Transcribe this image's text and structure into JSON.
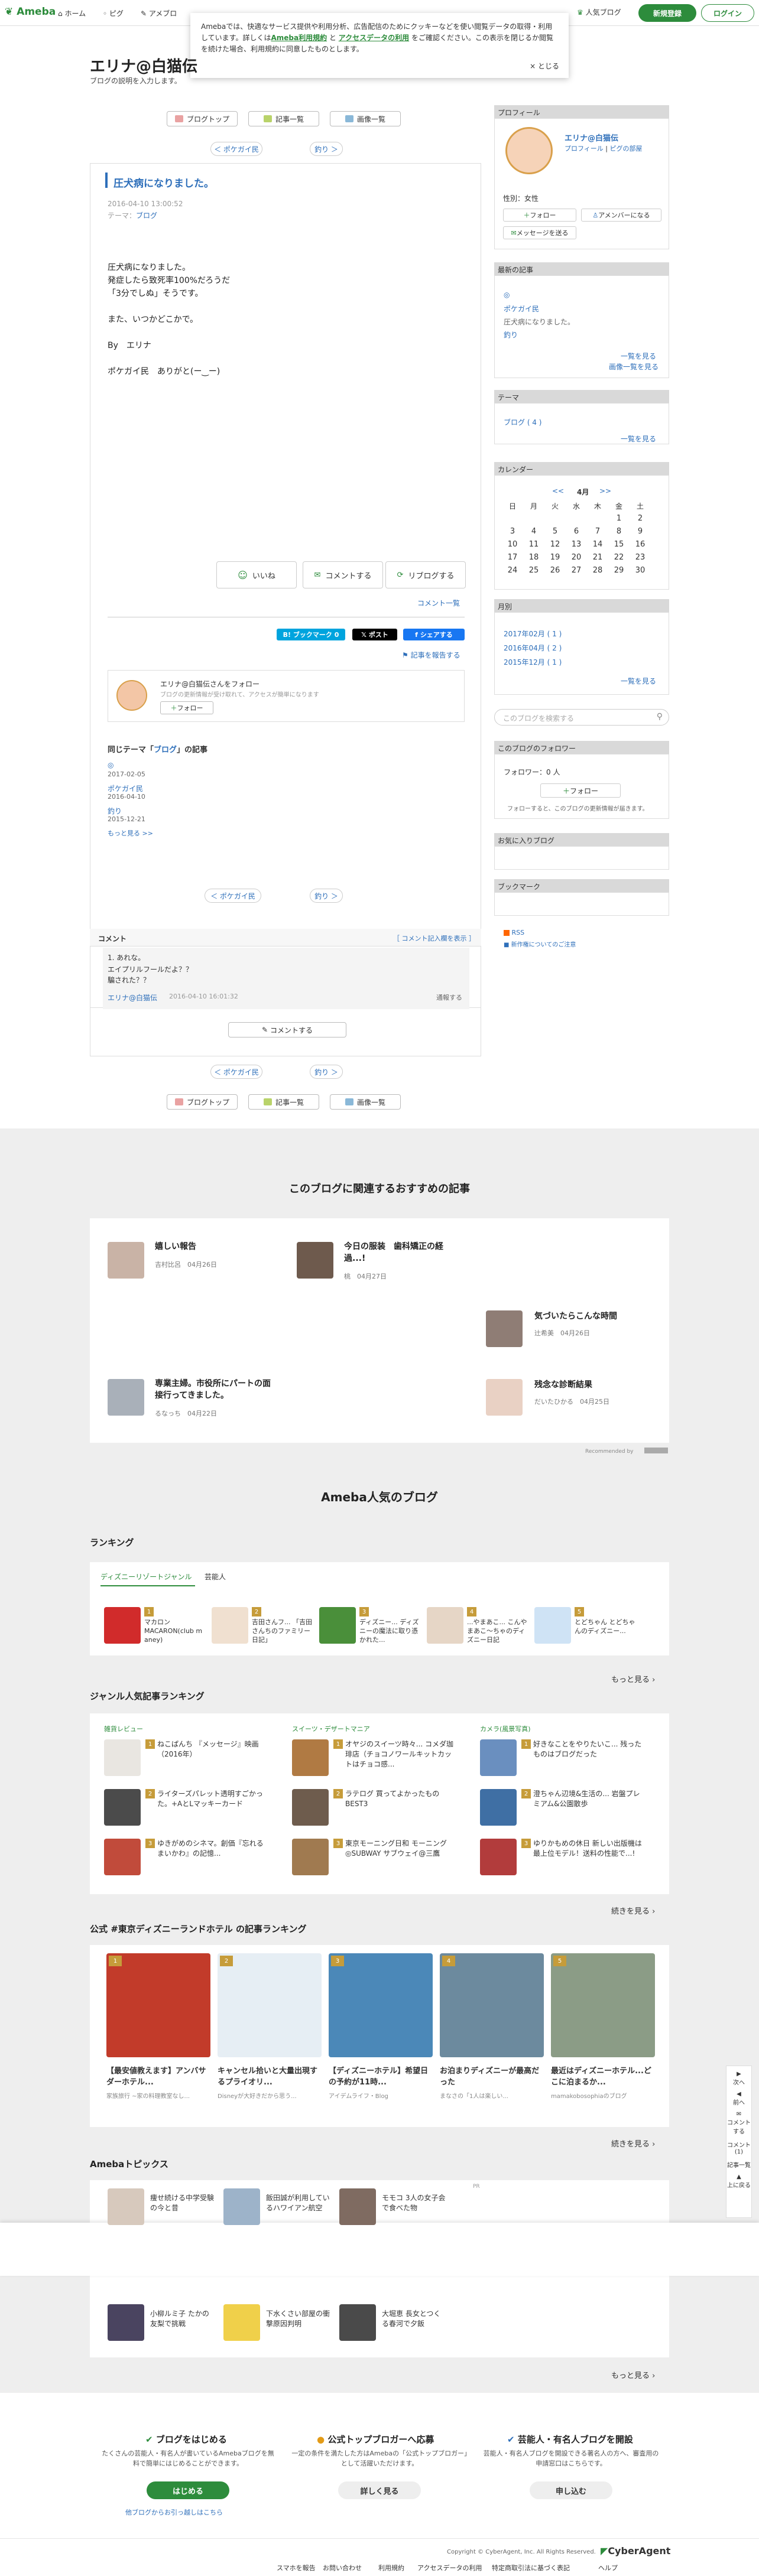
{
  "header": {
    "logo": "Ameba",
    "nav": [
      "ホーム",
      "ピグ",
      "アメブロ"
    ],
    "popular": "人気ブログ",
    "signup": "新規登録",
    "login": "ログイン"
  },
  "cookie": {
    "text1": "Amebaでは、快適なサービス提供や利用分析、広告配信のためにクッキーなどを使い閲覧データの取得・利用しています。詳しくは",
    "link1": "Ameba利用規約",
    "and": "と",
    "link2": "アクセスデータの利用",
    "text2": "をご確認ください。この表示を閉じるか閲覧を続けた場合、利用規約に同意したものとします。",
    "close": "× とじる"
  },
  "blog": {
    "title": "エリナ@白猫伝",
    "desc": "ブログの説明を入力します。"
  },
  "topbar": {
    "top": "ブログトップ",
    "list": "記事一覧",
    "images": "画像一覧",
    "prev": "＜ ポケガイ民",
    "next": "釣り ＞"
  },
  "article": {
    "title": "圧犬病になりました。",
    "date": "2016-04-10 13:00:52",
    "theme_label": "テーマ：",
    "theme": "ブログ",
    "lines": [
      "圧犬病になりました。",
      "発症したら致死率100%だろうだ",
      "「3分でしぬ」そうです。",
      "",
      "また、いつかどこかで。",
      "",
      "By　エリナ",
      "",
      "ポケガイ民　ありがと(ー‿ー)"
    ],
    "like": "いいね",
    "comment": "コメントする",
    "reblog": "リブログする",
    "comment_link": "コメント一覧",
    "share_hatena": "B! ブックマーク",
    "share_count": "0",
    "share_x": "ポスト",
    "share_fb": "シェアする",
    "reblog_link": "記事を報告する"
  },
  "follow": {
    "title": "エリナ@白猫伝さんをフォロー",
    "text": "ブログの更新情報が受け取れて、アクセスが簡単になります",
    "button": "フォロー"
  },
  "same_theme": {
    "heading_pre": "同じテーマ「",
    "heading_theme": "ブログ",
    "heading_post": "」の記事",
    "items": [
      {
        "title": "◎",
        "date": "2017-02-05"
      },
      {
        "title": "ポケガイ民",
        "date": "2016-04-10"
      },
      {
        "title": "釣り",
        "date": "2015-12-21"
      }
    ],
    "more": "もっと見る >>"
  },
  "comments": {
    "head": "コメント",
    "add": "［ コメント記入欄を表示 ］",
    "num": "1. あれな。",
    "text1": "エイプリルフールだよ？？",
    "text2": "騙された？？",
    "author": "エリナ@白猫伝",
    "date": "2016-04-10 16:01:32",
    "report": "通報する",
    "button": "コメントする"
  },
  "sidebar": {
    "profile_head": "プロフィール",
    "name": "エリナ@白猫伝",
    "profile_link": "プロフィール",
    "pig_link": "ピグの部屋",
    "sex": "性別：女性",
    "follow": "フォロー",
    "ameba_member": "アメンバーになる",
    "message": "メッセージを送る",
    "recent_head": "最新の記事",
    "recent": [
      "◎",
      "ポケガイ民",
      "圧犬病になりました。",
      "釣り"
    ],
    "recent_more1": "一覧を見る",
    "recent_more2": "画像一覧を見る",
    "theme_head": "テーマ",
    "theme_item": "ブログ ( 4 )",
    "theme_more": "一覧を見る",
    "cal_head": "カレンダー",
    "cal_month": "4月",
    "cal_prev": "<<",
    "cal_next": ">>",
    "cal_days": [
      "日",
      "月",
      "火",
      "水",
      "木",
      "金",
      "土"
    ],
    "cal_dates": [
      [
        "",
        "",
        "",
        "",
        "",
        "1",
        "2"
      ],
      [
        "3",
        "4",
        "5",
        "6",
        "7",
        "8",
        "9"
      ],
      [
        "10",
        "11",
        "12",
        "13",
        "14",
        "15",
        "16"
      ],
      [
        "17",
        "18",
        "19",
        "20",
        "21",
        "22",
        "23"
      ],
      [
        "24",
        "25",
        "26",
        "27",
        "28",
        "29",
        "30"
      ]
    ],
    "monthly_head": "月別",
    "months": [
      "2017年02月 ( 1 )",
      "2016年04月 ( 2 )",
      "2015年12月 ( 1 )"
    ],
    "monthly_more": "一覧を見る",
    "search_placeholder": "このブログを検索する",
    "follower_head": "このブログのフォロワー",
    "follower_count": "フォロワー：0 人",
    "follower_btn": "フォロー",
    "follower_note": "フォローすると、このブログの更新情報が届きます。",
    "fav_head": "お気に入りブログ",
    "bookmark_head": "ブックマーク",
    "rss": "RSS",
    "rss_note": "■ 新作権についてのご注意"
  },
  "related": {
    "title": "このブログに関連するおすすめの記事",
    "items": [
      {
        "title": "嬉しい報告",
        "meta": "吉村比呂　04月26日"
      },
      {
        "title": "今日の服装　歯科矯正の経過...!",
        "meta": "桃　04月27日"
      },
      {
        "title": "気づいたらこんな時間",
        "meta": "辻希美　04月26日"
      },
      {
        "title": "専業主婦。市役所にパートの面接行ってきました。",
        "meta": "るなっち　04月22日"
      },
      {
        "title": "残念な診断結果",
        "meta": "だいたひかる　04月25日"
      }
    ],
    "powered": "Recommended by"
  },
  "popular_blog": {
    "title": "Ameba人気のブログ",
    "ranking": "ランキング",
    "tab1": "ディズニーリゾートジャンル",
    "tab2": "芸能人",
    "rank_items": [
      "マカロン MACARON(club m aney)",
      "吉田さんフ... 「吉田さんちのファミリー日記」",
      "ディズニー... ディズニーの魔法に取り憑かれた...",
      "...やまあこ... こんやまあこ～ちゃのディズニー日記",
      "とどちゃん とどちゃんのディズニー..."
    ],
    "more": "もっと見る",
    "genre_title": "ジャンル人気記事ランキング",
    "genres": [
      {
        "name": "雑貨レビュー",
        "items": [
          "ねこぱんち 『メッセージ』映画（2016年）",
          "ライターズパレット透明すごかった。+AとLマッキーカード",
          "ゆきがめのシネマ。創価『忘れるまいかわ』の記憶..."
        ]
      },
      {
        "name": "スイーツ・デザートマニア",
        "items": [
          "オヤジのスイーツ時々... コメダ珈琲店（チョコノワールキットカットはチョコ感...",
          "ラテログ 買ってよかったものBEST3",
          "東京モーニング日和 モーニング◎SUBWAY サブウェイ@三鷹"
        ]
      },
      {
        "name": "カメラ(風景写真)",
        "items": [
          "好きなことをやりたいこ... 残ったものはブログだった",
          "澄ちゃん辺境&生活の... 岩盤プレミアム&公園散歩",
          "ゆりかもめの休日 新しい出版機は最上位モデル！送料の性能で...!"
        ]
      }
    ],
    "genre_more": "続きを見る",
    "official_title": "公式 #東京ディズニーランドホテル の記事ランキング",
    "official_items": [
      {
        "title": "【最安値教えます】アンバサダーホテル...",
        "meta": "家族旅行 ~家の料理教室なし..."
      },
      {
        "title": "キャンセル拾いと大量出現するプライオリ...",
        "meta": "Disneyが大好きだから思う..."
      },
      {
        "title": "【ディズニーホテル】希望日の予約が11時...",
        "meta": "アイデムライフ・Blog"
      },
      {
        "title": "お泊まりディズニーが最高だった",
        "meta": "まなさの「1人は楽しい..."
      },
      {
        "title": "最近はディズニーホテル...どこに泊まるか...",
        "meta": "mamakobosophiaのブログ"
      }
    ],
    "official_more": "続きを見る",
    "topics_title": "Amebaトピックス",
    "topics": [
      "痩せ続ける中学受験の今と昔",
      "飯田誠が利用しているハワイアン航空",
      "モモコ 3人の女子会で食べた物",
      "小柳ルミ子 たかの友梨で挑戦",
      "下水くさい部屋の衝撃原因判明",
      "大堀恵 長女とつくる春河で夕飯"
    ],
    "topics_pr": "PR",
    "topics_more": "もっと見る"
  },
  "footer": {
    "col1_title": "ブログをはじめる",
    "col1_text": "たくさんの芸能人・有名人が書いているAmebaブログを無料で簡単にはじめることができます。",
    "col1_btn": "はじめる",
    "col1_link": "他ブログからお引っ越しはこちら",
    "col2_title": "公式トップブロガーへ応募",
    "col2_text": "一定の条件を満たした方はAmebaの「公式トップブロガー」として活躍いただけます。",
    "col2_btn": "詳しく見る",
    "col3_title": "芸能人・有名人ブログを開設",
    "col3_text": "芸能人・有名人ブログを開設できる著名人の方へ、審査用の申請窓口はこちらです。",
    "col3_btn": "申し込む",
    "copyright": "Copyright © CyberAgent, Inc. All Rights Reserved.",
    "brand": "CyberAgent",
    "links": [
      "スマホを報告",
      "お問い合わせ",
      "利用規約",
      "アクセスデータの利用",
      "特定商取引法に基づく表記",
      "ヘルプ"
    ]
  },
  "float": {
    "next": "次へ",
    "prev": "前へ",
    "comment": "コメントする",
    "comment_count": "コメント(1)",
    "list": "記事一覧",
    "top": "上に戻る"
  }
}
